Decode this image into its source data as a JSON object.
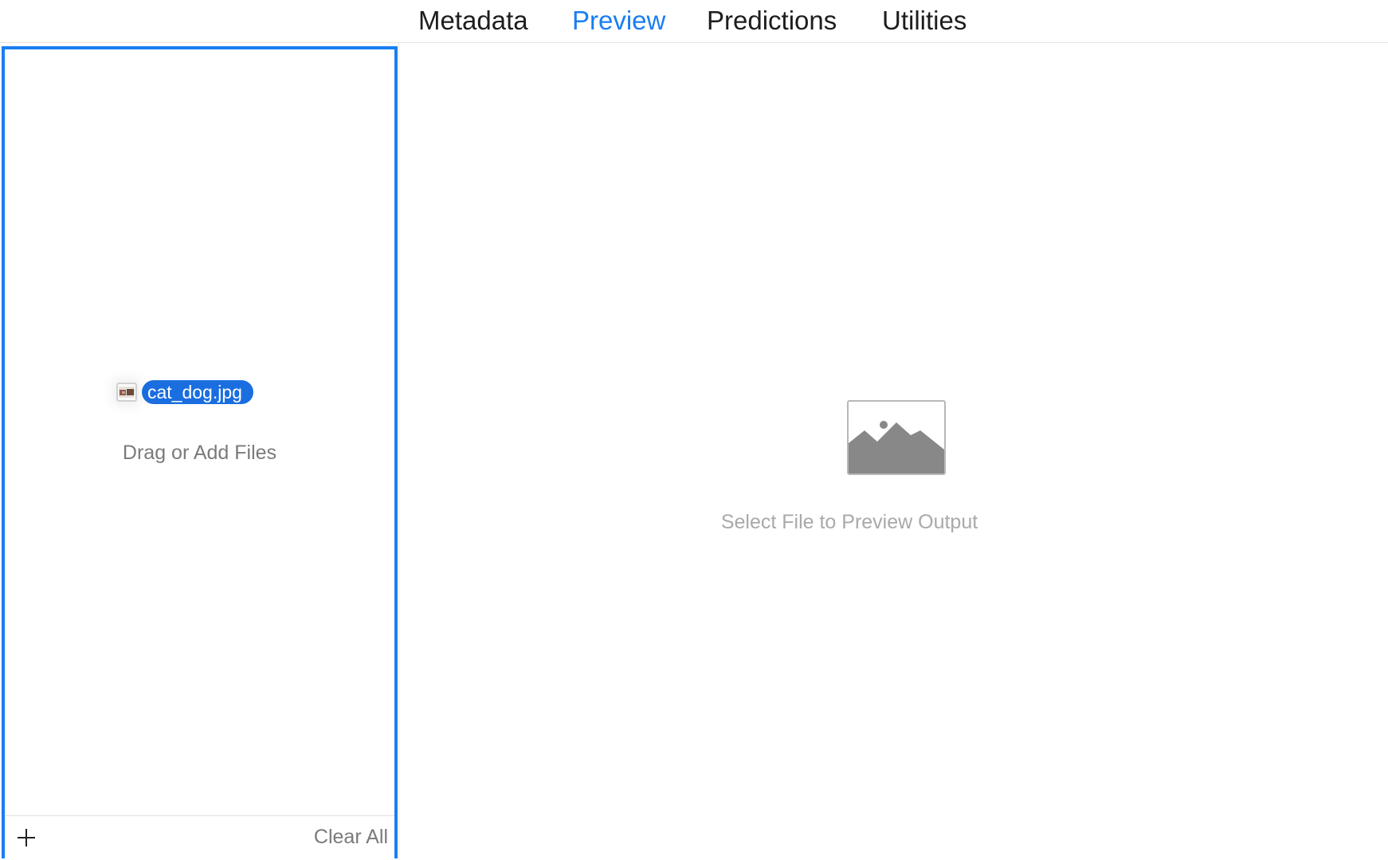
{
  "tabs": [
    {
      "label": "Metadata",
      "active": false
    },
    {
      "label": "Preview",
      "active": true
    },
    {
      "label": "Predictions",
      "active": false
    },
    {
      "label": "Utilities",
      "active": false
    }
  ],
  "file_panel": {
    "dragged_file_name": "cat_dog.jpg",
    "drop_hint": "Drag or Add Files",
    "footer": {
      "add_icon": "plus-icon",
      "clear_label": "Clear All"
    }
  },
  "preview": {
    "placeholder_icon": "image-placeholder-icon",
    "hint": "Select File to Preview Output"
  },
  "colors": {
    "accent": "#1a7ef2",
    "drag_pill": "#1a6ee0",
    "secondary_text": "#7a7a7a",
    "placeholder_text": "#a9a9a9"
  }
}
